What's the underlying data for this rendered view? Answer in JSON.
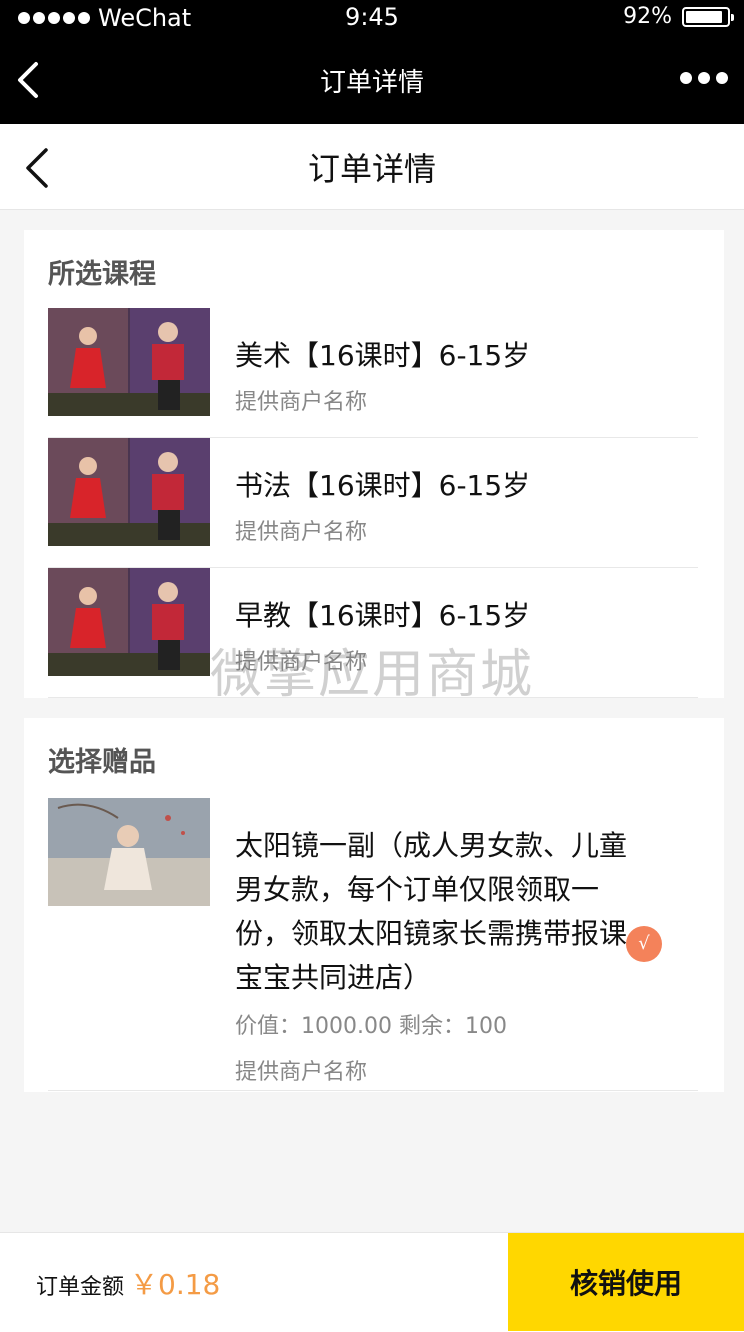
{
  "status_bar": {
    "carrier": "WeChat",
    "time": "9:45",
    "battery_text": "92%",
    "battery_level": 0.92
  },
  "wechat_nav": {
    "title": "订单详情",
    "back_icon": "chevron-left-icon",
    "more_icon": "more-dots-icon"
  },
  "header": {
    "title": "订单详情",
    "back_icon": "chevron-left-icon"
  },
  "courses": {
    "section_title": "所选课程",
    "items": [
      {
        "name": "美术【16课时】6-15岁",
        "merchant": "提供商户名称"
      },
      {
        "name": "书法【16课时】6-15岁",
        "merchant": "提供商户名称"
      },
      {
        "name": "早教【16课时】6-15岁",
        "merchant": "提供商户名称"
      }
    ]
  },
  "gift": {
    "section_title": "选择赠品",
    "description": "太阳镜一副（成人男女款、儿童男女款，每个订单仅限领取一份，领取太阳镜家长需携带报课宝宝共同进店）",
    "value_label": "价值：",
    "value": "1000.00",
    "remain_label": "剩余：",
    "remain": "100",
    "merchant": "提供商户名称",
    "selected_mark": "√"
  },
  "watermark": "微擎应用商城",
  "footer": {
    "amount_label": "订单金额",
    "amount": "￥0.18",
    "button_label": "核销使用"
  },
  "colors": {
    "accent_yellow": "#ffd700",
    "price_orange": "#f49b45",
    "check_orange": "#f4825a"
  }
}
